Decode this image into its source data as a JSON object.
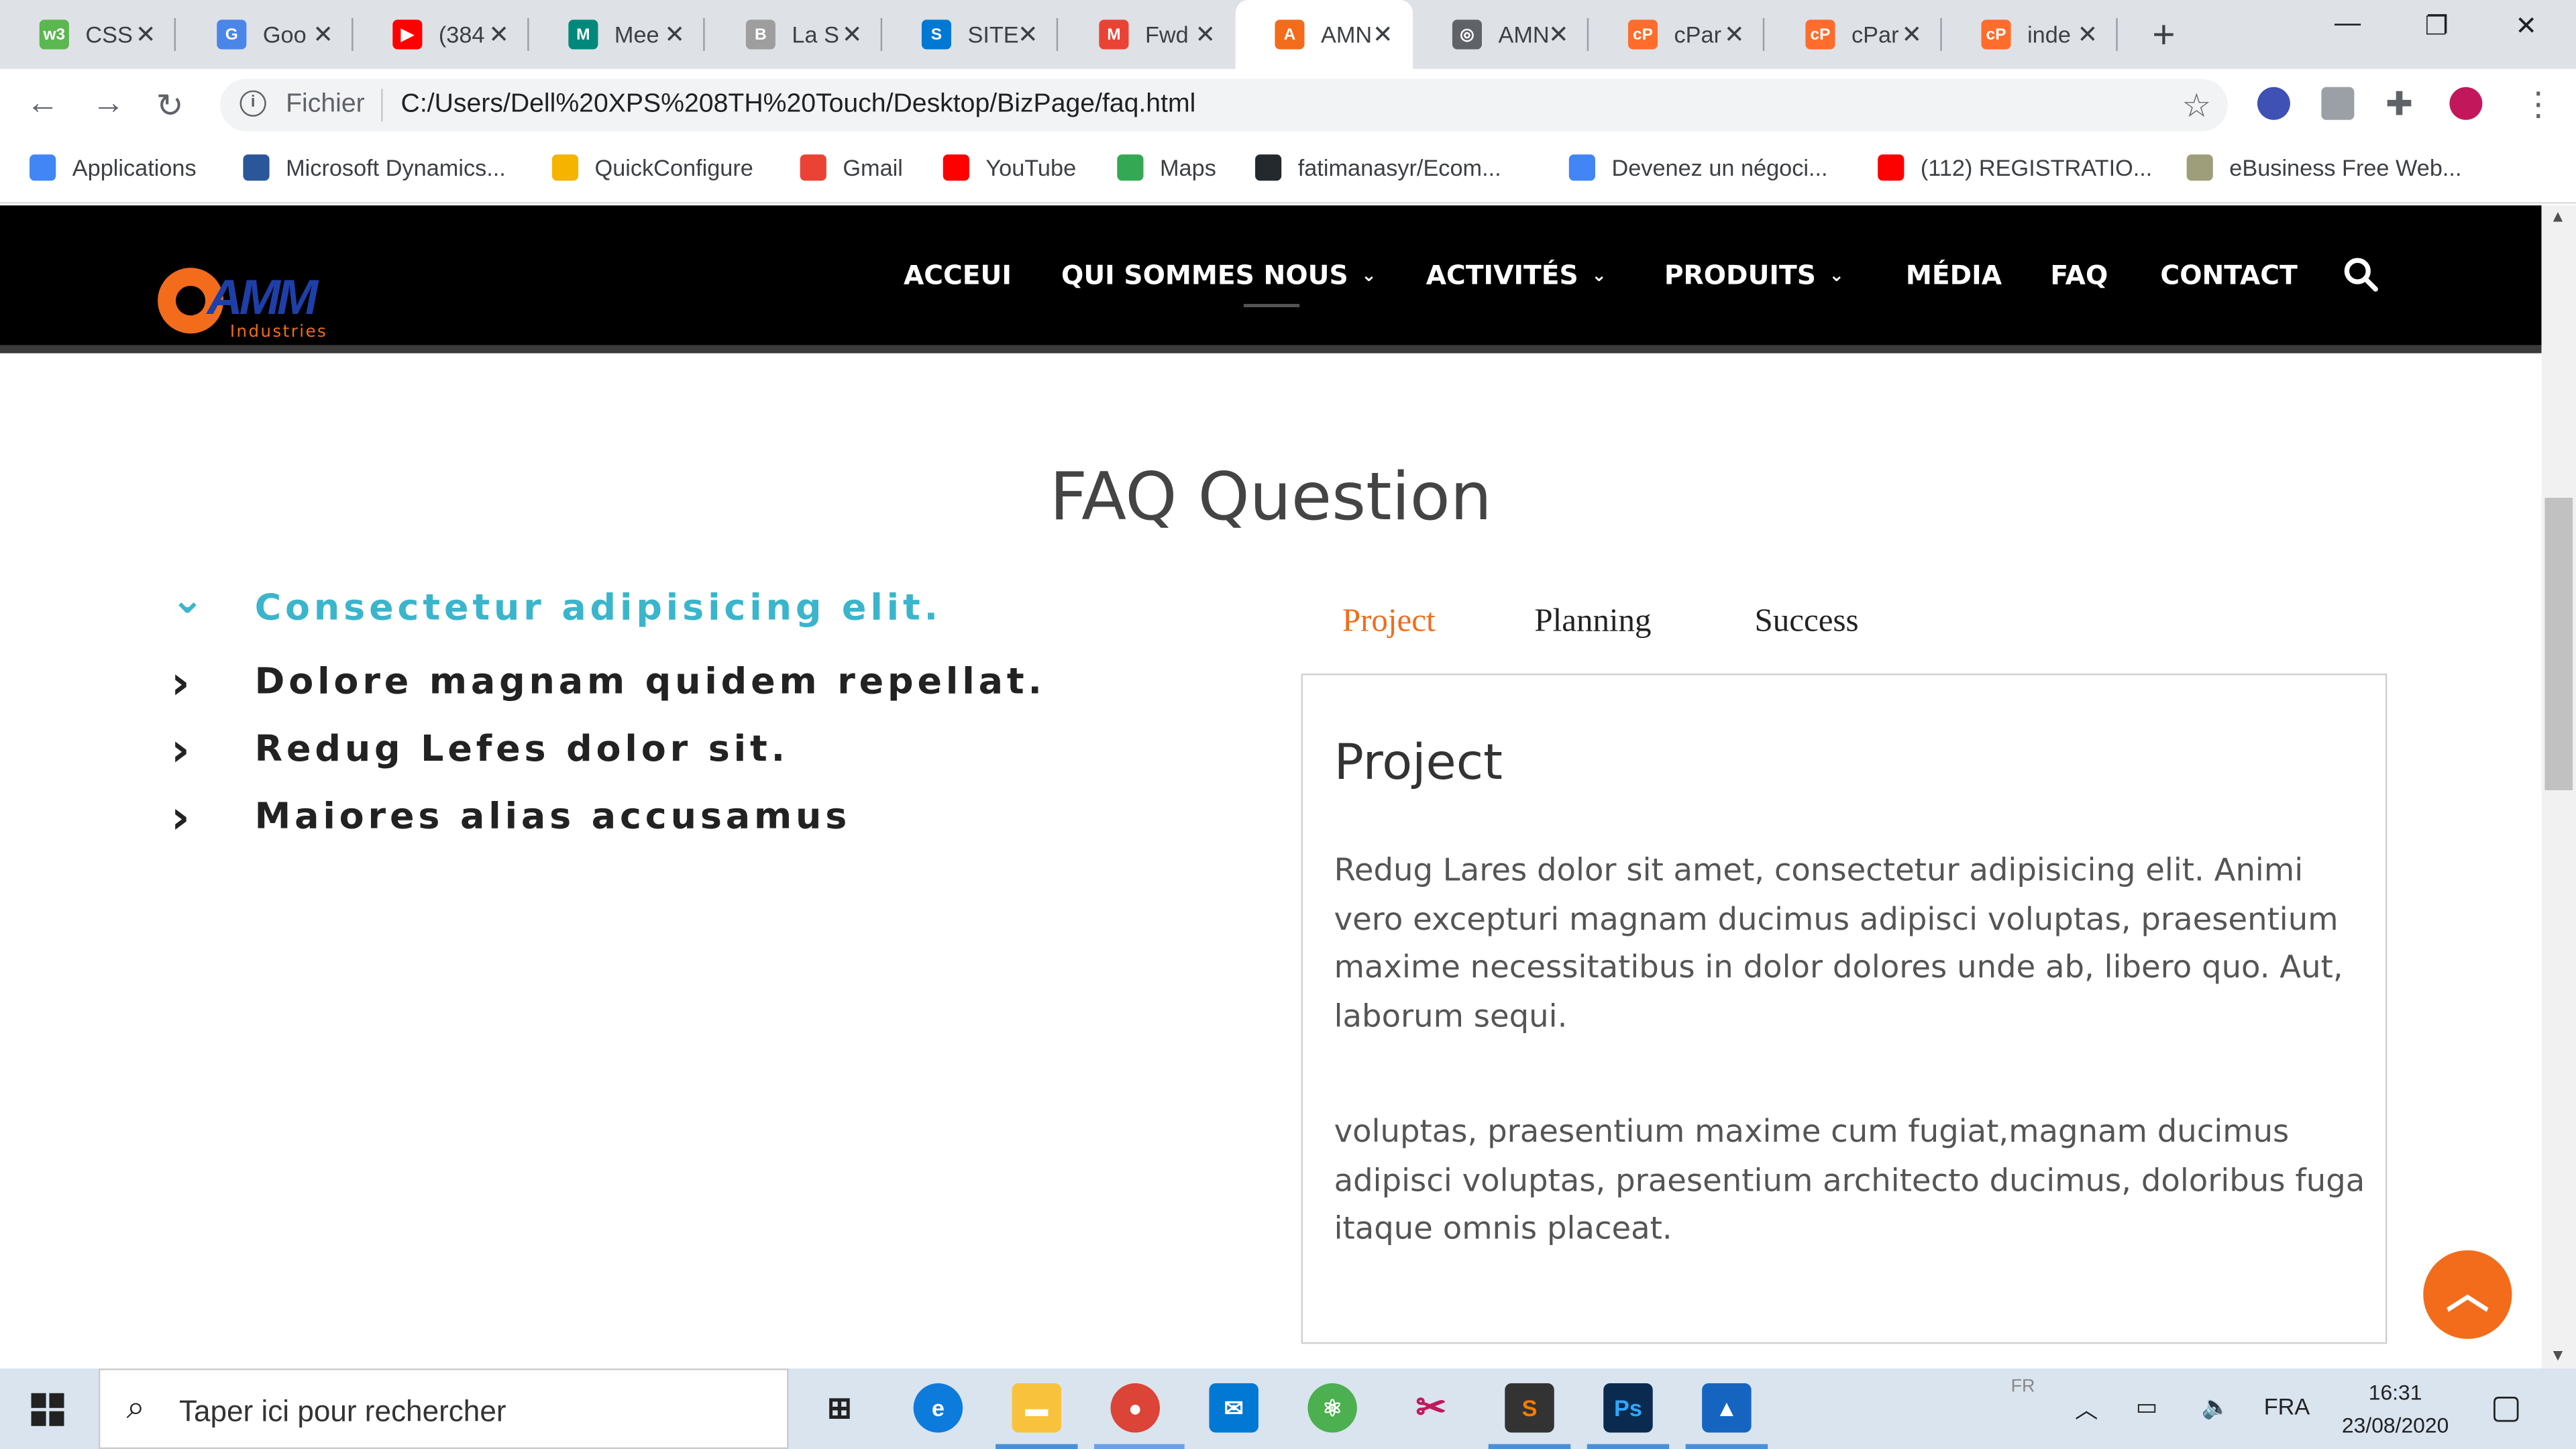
{
  "browser": {
    "tabs": [
      {
        "label": "CSS",
        "fav_color": "#5bb750",
        "fav_text": "w3"
      },
      {
        "label": "Goo",
        "fav_color": "#4a86e8",
        "fav_text": "G"
      },
      {
        "label": "(384",
        "fav_color": "#ff0000",
        "fav_text": "▶"
      },
      {
        "label": "Mee",
        "fav_color": "#00897b",
        "fav_text": "M"
      },
      {
        "label": "La S",
        "fav_color": "#9e9e9e",
        "fav_text": "B"
      },
      {
        "label": "SITE",
        "fav_color": "#0078d4",
        "fav_text": "S"
      },
      {
        "label": "Fwd",
        "fav_color": "#ea4335",
        "fav_text": "M"
      },
      {
        "label": "AMN",
        "fav_color": "#f26c1b",
        "fav_text": "A"
      },
      {
        "label": "AMN",
        "fav_color": "#5f6368",
        "fav_text": "◎"
      },
      {
        "label": "cPar",
        "fav_color": "#ff6c2c",
        "fav_text": "cP"
      },
      {
        "label": "cPar",
        "fav_color": "#ff6c2c",
        "fav_text": "cP"
      },
      {
        "label": "inde",
        "fav_color": "#ff6c2c",
        "fav_text": "cP"
      }
    ],
    "active_tab_index": 7,
    "omnibox": {
      "scheme_label": "Fichier",
      "url": "C:/Users/Dell%20XPS%208TH%20Touch/Desktop/BizPage/faq.html"
    },
    "bookmarks": [
      {
        "label": "Applications",
        "fav_color": "#4285f4"
      },
      {
        "label": "Microsoft Dynamics...",
        "fav_color": "#2b579a"
      },
      {
        "label": "QuickConfigure",
        "fav_color": "#f4b400"
      },
      {
        "label": "Gmail",
        "fav_color": "#ea4335"
      },
      {
        "label": "YouTube",
        "fav_color": "#ff0000"
      },
      {
        "label": "Maps",
        "fav_color": "#34a853"
      },
      {
        "label": "fatimanasyr/Ecom...",
        "fav_color": "#24292e"
      },
      {
        "label": "Devenez un négoci...",
        "fav_color": "#4285f4"
      },
      {
        "label": "(112) REGISTRATIO...",
        "fav_color": "#ff0000"
      },
      {
        "label": "eBusiness Free Web...",
        "fav_color": "#9e9e7a"
      }
    ]
  },
  "site": {
    "logo": {
      "mark": "AMM",
      "subtitle": "Industries"
    },
    "menu": [
      {
        "label": "ACCEUI"
      },
      {
        "label": "QUI SOMMES NOUS",
        "dropdown": true
      },
      {
        "label": "ACTIVITÉS",
        "dropdown": true
      },
      {
        "label": "PRODUITS",
        "dropdown": true
      },
      {
        "label": "MÉDIA"
      },
      {
        "label": "FAQ"
      },
      {
        "label": "CONTACT"
      }
    ],
    "faq_title": "FAQ Question",
    "questions": [
      {
        "text": "Consectetur adipisicing elit.",
        "open": true
      },
      {
        "text": "Dolore magnam quidem repellat.",
        "open": false
      },
      {
        "text": "Redug Lefes dolor sit.",
        "open": false
      },
      {
        "text": "Maiores alias accusamus",
        "open": false
      }
    ],
    "panel_tabs": [
      "Project",
      "Planning",
      "Success"
    ],
    "active_panel_tab": 0,
    "panel": {
      "heading": "Project",
      "paragraph1": "Redug Lares dolor sit amet, consectetur adipisicing elit. Animi vero excepturi magnam ducimus adipisci voluptas, praesentium maxime necessitatibus in dolor dolores unde ab, libero quo. Aut, laborum sequi.",
      "paragraph2": "voluptas, praesentium maxime cum fugiat,magnam ducimus adipisci voluptas, praesentium architecto ducimus, doloribus fuga itaque omnis placeat."
    },
    "accent_color": "#f26c1b",
    "question_open_color": "#3ab5cc"
  },
  "taskbar": {
    "search_placeholder": "Taper ici pour rechercher",
    "input_indicator": "FR",
    "language": "FRA",
    "time": "16:31",
    "date": "23/08/2020"
  }
}
